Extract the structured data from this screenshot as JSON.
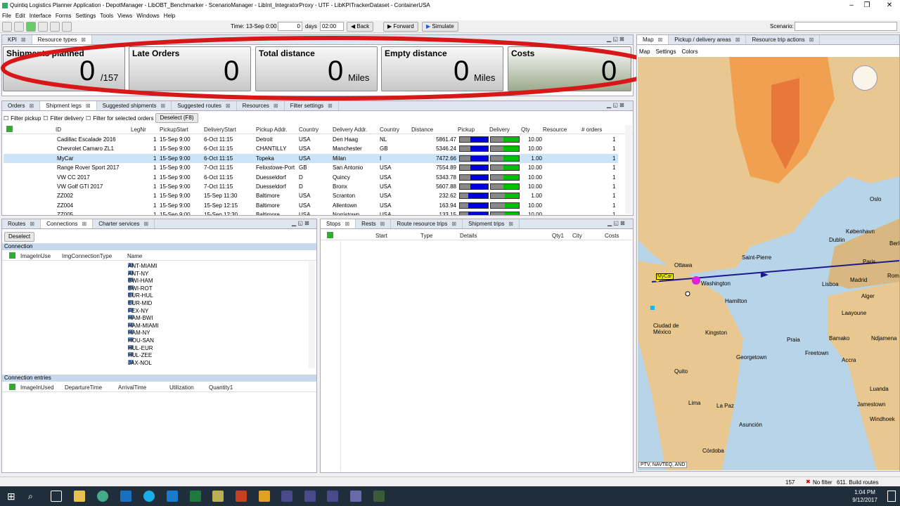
{
  "window": {
    "title": "Quintiq Logistics Planner Application - DepotManager - LibOBT_Benchmarker - ScenarioManager - LibInt_IntegratorProxy - UTF - LibKPITrackerDataset - ContainerUSA",
    "min": "–",
    "max": "❐",
    "close": "✕"
  },
  "menu": [
    "File",
    "Edit",
    "Interface",
    "Forms",
    "Settings",
    "Tools",
    "Views",
    "Windows",
    "Help"
  ],
  "toolbar": {
    "time_label": "Time: 13-Sep 0:00",
    "days_value": "0",
    "days_label": "days",
    "clock_value": "02:00",
    "back": "Back",
    "forward": "Forward",
    "simulate": "Simulate",
    "scenario_label": "Scenario:"
  },
  "kpi_tabs": [
    "KPI",
    "Resource types"
  ],
  "kpis": [
    {
      "title": "Shipments planned",
      "value": "0",
      "unit": "/157"
    },
    {
      "title": "Late Orders",
      "value": "0",
      "unit": ""
    },
    {
      "title": "Total distance",
      "value": "0",
      "unit": "Miles"
    },
    {
      "title": "Empty distance",
      "value": "0",
      "unit": "Miles"
    },
    {
      "title": "Costs",
      "value": "0",
      "unit": ""
    }
  ],
  "mid_tabs": [
    "Orders",
    "Shipment legs",
    "Suggested shipments",
    "Suggested routes",
    "Resources",
    "Filter settings"
  ],
  "filters": {
    "pickup": "Filter pickup",
    "delivery": "Filter delivery",
    "selected": "Filter for selected orders",
    "deselect": "Deselect (F8)"
  },
  "legs_columns": [
    "ID",
    "LegNr",
    "PickupStart",
    "DeliveryStart",
    "Pickup Addr.",
    "Country",
    "Delivery Addr.",
    "Country",
    "Distance",
    "Pickup",
    "Delivery",
    "Qty",
    "Resource",
    "# orders"
  ],
  "legs_rows": [
    {
      "id": "Cadillac Escalade 2016",
      "leg": "1",
      "ps": "15-Sep 9:00",
      "ds": "6-Oct 11:15",
      "pa": "Detroit",
      "pc": "USA",
      "da": "Den Haag",
      "dc": "NL",
      "dist": "5861.47",
      "qty": "10.00",
      "orders": "1",
      "pf": 0.63,
      "df": 0.55
    },
    {
      "id": "Chevrolet Camaro ZL1",
      "leg": "1",
      "ps": "15-Sep 9:00",
      "ds": "6-Oct 11:15",
      "pa": "CHANTILLY",
      "pc": "USA",
      "da": "Manchester",
      "dc": "GB",
      "dist": "5346.24",
      "qty": "10.00",
      "orders": "1",
      "pf": 0.63,
      "df": 0.55
    },
    {
      "id": "MyCar",
      "leg": "1",
      "ps": "15-Sep 9:00",
      "ds": "6-Oct 11:15",
      "pa": "Topeka",
      "pc": "USA",
      "da": "Milan",
      "dc": "I",
      "dist": "7472.66",
      "qty": "1.00",
      "orders": "1",
      "pf": 0.63,
      "df": 0.55
    },
    {
      "id": "Range Rover Sport 2017",
      "leg": "1",
      "ps": "15-Sep 9:00",
      "ds": "7-Oct 11:15",
      "pa": "Felixstowe-Port",
      "pc": "GB",
      "da": "San Antonio",
      "dc": "USA",
      "dist": "7554.89",
      "qty": "10.00",
      "orders": "1",
      "pf": 0.63,
      "df": 0.55
    },
    {
      "id": "VW CC 2017",
      "leg": "1",
      "ps": "15-Sep 9:00",
      "ds": "6-Oct 11:15",
      "pa": "Duesseldorf",
      "pc": "D",
      "da": "Quincy",
      "dc": "USA",
      "dist": "5343.78",
      "qty": "10.00",
      "orders": "1",
      "pf": 0.63,
      "df": 0.55
    },
    {
      "id": "VW Golf GTI 2017",
      "leg": "1",
      "ps": "15-Sep 9:00",
      "ds": "7-Oct 11:15",
      "pa": "Duesseldorf",
      "pc": "D",
      "da": "Bronx",
      "dc": "USA",
      "dist": "5607.88",
      "qty": "10.00",
      "orders": "1",
      "pf": 0.63,
      "df": 0.55
    },
    {
      "id": "ZZ002",
      "leg": "1",
      "ps": "15-Sep 9:00",
      "ds": "15-Sep 11:30",
      "pa": "Baltimore",
      "pc": "USA",
      "da": "Scranton",
      "dc": "USA",
      "dist": "232.62",
      "qty": "1.00",
      "orders": "1",
      "pf": 0.7,
      "df": 0.5
    },
    {
      "id": "ZZ004",
      "leg": "1",
      "ps": "15-Sep 9:00",
      "ds": "15-Sep 12:15",
      "pa": "Baltimore",
      "pc": "USA",
      "da": "Allentown",
      "dc": "USA",
      "dist": "163.94",
      "qty": "10.00",
      "orders": "1",
      "pf": 0.7,
      "df": 0.5
    },
    {
      "id": "ZZ005",
      "leg": "1",
      "ps": "15-Sep 9:00",
      "ds": "15-Sep 12:30",
      "pa": "Baltimore",
      "pc": "USA",
      "da": "Norristown",
      "dc": "USA",
      "dist": "133.15",
      "qty": "10.00",
      "orders": "1",
      "pf": 0.7,
      "df": 0.5
    }
  ],
  "left_tabs": [
    "Routes",
    "Connections",
    "Charter services"
  ],
  "connection": {
    "deselect": "Deselect",
    "section": "Connection",
    "cols": [
      "ImageInUse",
      "ImgConnectionType",
      "Name"
    ],
    "names": [
      "ANT-MIAMI",
      "ANT-NY",
      "BWI-HAM",
      "BWI-ROT",
      "EUR-HUL",
      "EUR-MID",
      "FEX-NY",
      "HAM-BWI",
      "HAM-MIAMI",
      "HAM-NY",
      "HOU-SAN",
      "HUL-EUR",
      "HUL-ZEE",
      "JAX-NOL"
    ],
    "entries_section": "Connection entries",
    "entry_cols": [
      "ImageInUsed",
      "DepartureTime",
      "ArrivalTime",
      "Utilization",
      "Quantity1"
    ]
  },
  "stops_tabs": [
    "Stops",
    "Rests",
    "Route resource trips",
    "Shipment trips"
  ],
  "stops_cols": [
    "Start",
    "Type",
    "Details",
    "Qty1",
    "City",
    "Costs"
  ],
  "map_tabs": [
    "Map",
    "Pickup / delivery areas",
    "Resource trip actions"
  ],
  "map_sub": [
    "Map",
    "Settings",
    "Colors"
  ],
  "map_labels": [
    "Oslo",
    "København",
    "Dublin",
    "Berli",
    "Paris",
    "Lisboa",
    "Madrid",
    "Rom",
    "Alger",
    "Ottawa",
    "Saint-Pierre",
    "Washington",
    "Hamilton",
    "Ciudad de México",
    "Kingston",
    "Laayoune",
    "Praia",
    "Bamako",
    "Ndjamena",
    "Freetown",
    "Accra",
    "Georgetown",
    "Quito",
    "Luanda",
    "Lima",
    "La Paz",
    "Jamestown",
    "Windhoek",
    "Asunción",
    "Córdoba",
    "MyCar"
  ],
  "map_copyright": "PTV, NAVTEQ, AND",
  "status": {
    "count": "157",
    "filter": "No filter",
    "routes": "611. Build routes"
  },
  "clock": {
    "time": "1:04 PM",
    "date": "9/12/2017"
  },
  "colors": {
    "kpi_ring": "#d81818",
    "route_line": "#1a1a8c",
    "header_tab": "#dfe6ef"
  }
}
